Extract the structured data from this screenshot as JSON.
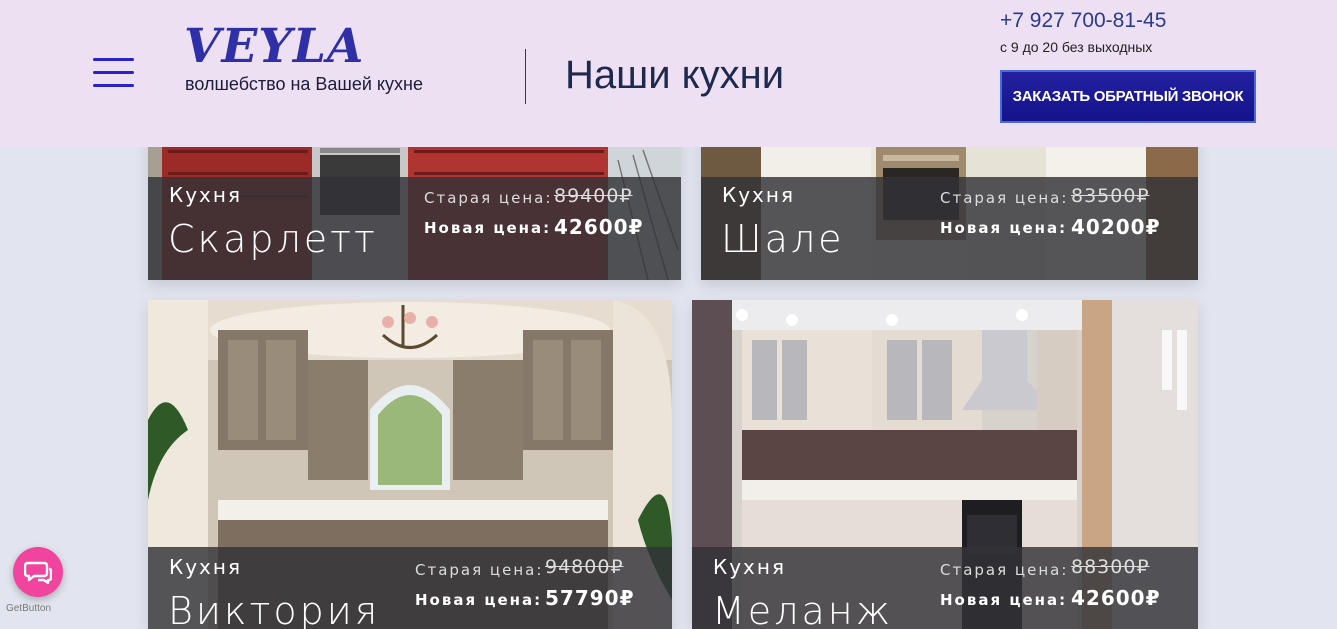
{
  "header": {
    "logo_text": "VEYLA",
    "tagline": "волшебство на Вашей кухне",
    "page_title": "Наши кухни",
    "phone": "+7 927 700-81-45",
    "hours": "с 9 до 20 без выходных",
    "callback_label": "ЗАКАЗАТЬ ОБРАТНЫЙ ЗВОНОК"
  },
  "cards": [
    {
      "kitchen_label": "Кухня",
      "name": "Скарлетт",
      "old_label": "Старая цена:",
      "old_price": "89400₽",
      "new_label": "Новая цена:",
      "new_price": "42600₽"
    },
    {
      "kitchen_label": "Кухня",
      "name": "Шале",
      "old_label": "Старая цена:",
      "old_price": "83500₽",
      "new_label": "Новая цена:",
      "new_price": "40200₽"
    },
    {
      "kitchen_label": "Кухня",
      "name": "Виктория",
      "old_label": "Старая цена:",
      "old_price": "94800₽",
      "new_label": "Новая цена:",
      "new_price": "57790₽"
    },
    {
      "kitchen_label": "Кухня",
      "name": "Меланж",
      "old_label": "Старая цена:",
      "old_price": "88300₽",
      "new_label": "Новая цена:",
      "new_price": "42600₽"
    }
  ],
  "widget": {
    "brand_label": "GetButton",
    "icon": "chat-bubbles-icon"
  },
  "colors": {
    "header_bg": "#eee0f3",
    "brand_blue": "#2f2fa8",
    "button_bg": "#1a1996",
    "widget_pink": "#f0449f"
  }
}
